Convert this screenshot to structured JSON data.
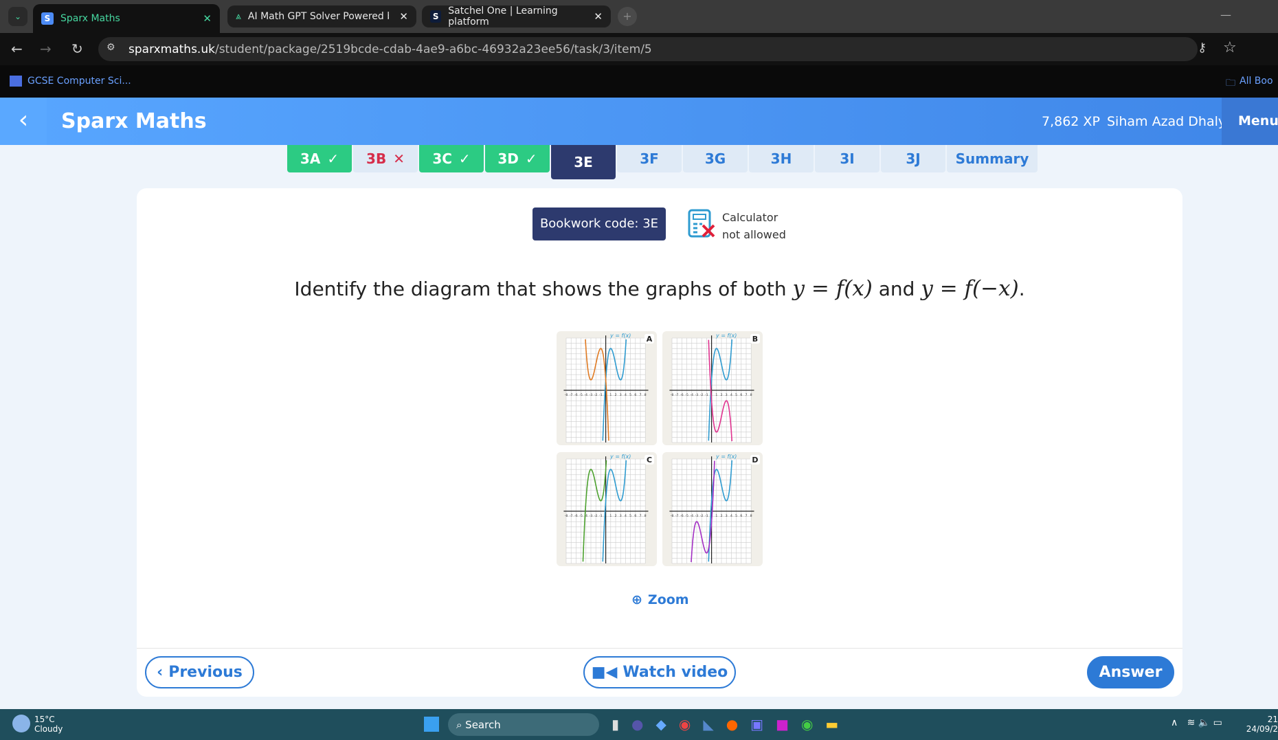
{
  "browser": {
    "tabs": [
      {
        "label": "Sparx Maths",
        "icon": "S",
        "active": true
      },
      {
        "label": "AI Math GPT Solver Powered by",
        "icon": "compass-icon"
      },
      {
        "label": "Satchel One | Learning platform",
        "icon": "S"
      }
    ],
    "url_domain": "sparxmaths.uk",
    "url_path": "/student/package/2519bcde-cdab-4ae9-a6bc-46932a23ee56/task/3/item/5",
    "bookmark": "GCSE Computer Sci...",
    "all_bookmarks": "All Boo"
  },
  "header": {
    "title": "Sparx Maths",
    "xp": "7,862 XP",
    "user": "Siham Azad Dhaly",
    "menu": "Menu",
    "color": "#4a96f5"
  },
  "task_tabs": [
    {
      "label": "3A",
      "status": "correct"
    },
    {
      "label": "3B",
      "status": "wrong"
    },
    {
      "label": "3C",
      "status": "correct"
    },
    {
      "label": "3D",
      "status": "correct"
    },
    {
      "label": "3E",
      "status": "current"
    },
    {
      "label": "3F"
    },
    {
      "label": "3G"
    },
    {
      "label": "3H"
    },
    {
      "label": "3I"
    },
    {
      "label": "3J"
    },
    {
      "label": "Summary"
    }
  ],
  "bookwork": "Bookwork code: 3E",
  "calculator": {
    "line1": "Calculator",
    "line2": "not allowed"
  },
  "question": {
    "text": "Identify the diagram that shows the graphs of both ",
    "m1": "y = f(x)",
    "and": " and ",
    "m2": "y = f(−x)",
    "end": "."
  },
  "diagram": {
    "curve_label": "y = f(x)",
    "x_ticks": [
      "-8",
      "-7",
      "-6",
      "-5",
      "-4",
      "-3",
      "-2",
      "-1",
      "1",
      "2",
      "3",
      "4",
      "5",
      "6",
      "7",
      "8"
    ],
    "y_range": [
      -10,
      10
    ],
    "x_range": [
      -8,
      8
    ],
    "base_color": "#2e9bd0",
    "options": [
      {
        "letter": "A",
        "transform": "f(-x)",
        "color": "#e07a22"
      },
      {
        "letter": "B",
        "transform": "-f(x)",
        "color": "#e0338f"
      },
      {
        "letter": "C",
        "transform": "f(x+4)",
        "color": "#4ca12e"
      },
      {
        "letter": "D",
        "transform": "-f(-x)",
        "color": "#a32fc4"
      }
    ]
  },
  "zoom": "Zoom",
  "buttons": {
    "previous": "Previous",
    "watch": "Watch video",
    "answer": "Answer"
  },
  "taskbar": {
    "temp": "15°C",
    "weather": "Cloudy",
    "search": "Search",
    "time": "21",
    "date": "24/09/2"
  }
}
